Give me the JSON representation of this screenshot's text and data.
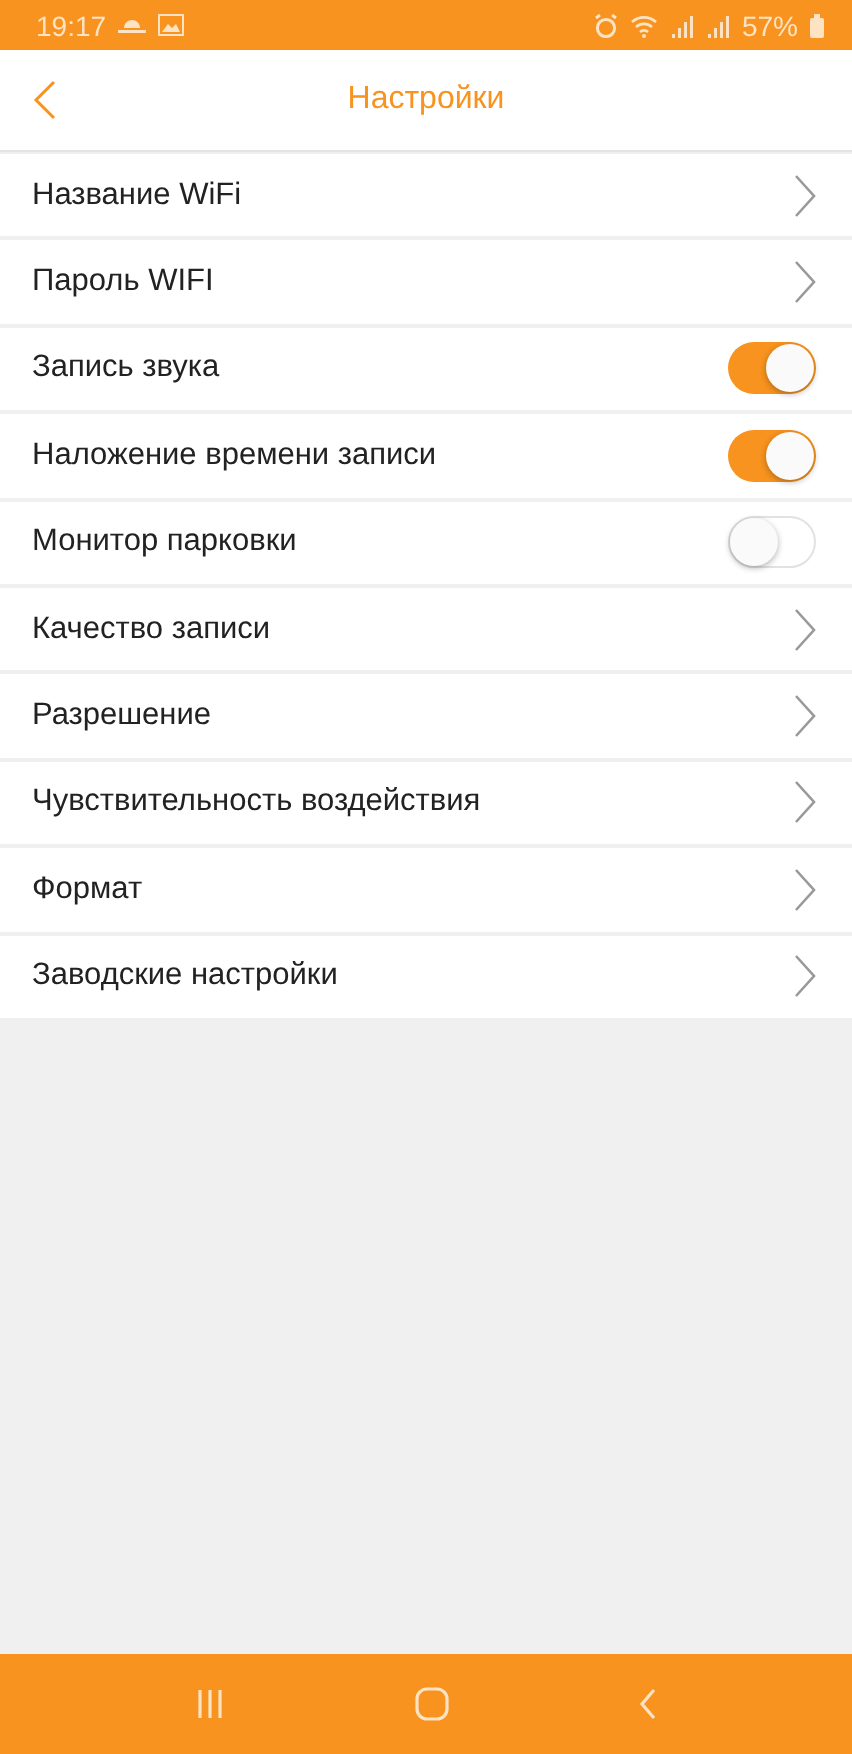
{
  "status_bar": {
    "time": "19:17",
    "battery": "57%"
  },
  "header": {
    "title": "Настройки"
  },
  "settings": [
    {
      "kind": "link",
      "label": "Название WiFi"
    },
    {
      "kind": "link",
      "label": "Пароль WIFI"
    },
    {
      "kind": "toggle",
      "label": "Запись звука",
      "on": true
    },
    {
      "kind": "toggle",
      "label": "Наложение времени записи",
      "on": true
    },
    {
      "kind": "toggle",
      "label": "Монитор парковки",
      "on": false
    },
    {
      "kind": "link",
      "label": "Качество записи"
    },
    {
      "kind": "link",
      "label": "Разрешение"
    },
    {
      "kind": "link",
      "label": "Чувствительность воздействия"
    },
    {
      "kind": "link",
      "label": "Формат"
    },
    {
      "kind": "link",
      "label": "Заводские настройки"
    }
  ]
}
